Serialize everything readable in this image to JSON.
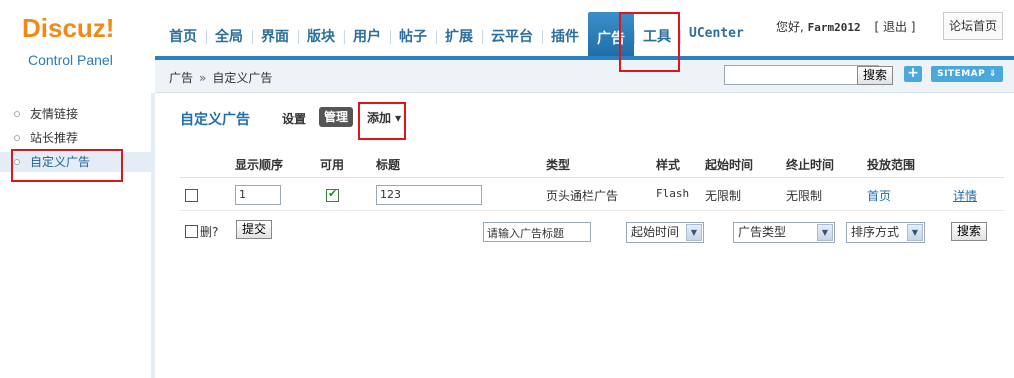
{
  "logo": {
    "main": "Discuz!",
    "sub": "Control Panel"
  },
  "nav": [
    "首页",
    "全局",
    "界面",
    "版块",
    "用户",
    "帖子",
    "扩展",
    "云平台",
    "插件",
    "广告",
    "工具",
    "UCenter"
  ],
  "user": {
    "greeting": "您好,",
    "name": "Farm2012",
    "logout": "[ 退出 ]",
    "forum_home": "论坛首页"
  },
  "crumb": {
    "parent": "广告",
    "sep": "»",
    "current": "自定义广告",
    "search_btn": "搜索",
    "plus": "+",
    "sitemap": "SITEMAP ⇓"
  },
  "sidebar": [
    "友情链接",
    "站长推荐",
    "自定义广告"
  ],
  "page": {
    "title": "自定义广告",
    "tab_setting": "设置",
    "tab_manage": "管理",
    "tab_add": "添加 ▾"
  },
  "table": {
    "headers": [
      "显示顺序",
      "可用",
      "标题",
      "类型",
      "样式",
      "起始时间",
      "终止时间",
      "投放范围"
    ],
    "row": {
      "order": "1",
      "title": "123",
      "type": "页头通栏广告",
      "style": "Flash",
      "start": "无限制",
      "end": "无限制",
      "scope": "首页",
      "detail": "详情"
    }
  },
  "footer": {
    "delete_label": "删?",
    "submit": "提交",
    "title_placeholder": "请输入广告标题",
    "select_start": "起始时间",
    "select_type": "广告类型",
    "select_sort": "排序方式",
    "search": "搜索"
  }
}
